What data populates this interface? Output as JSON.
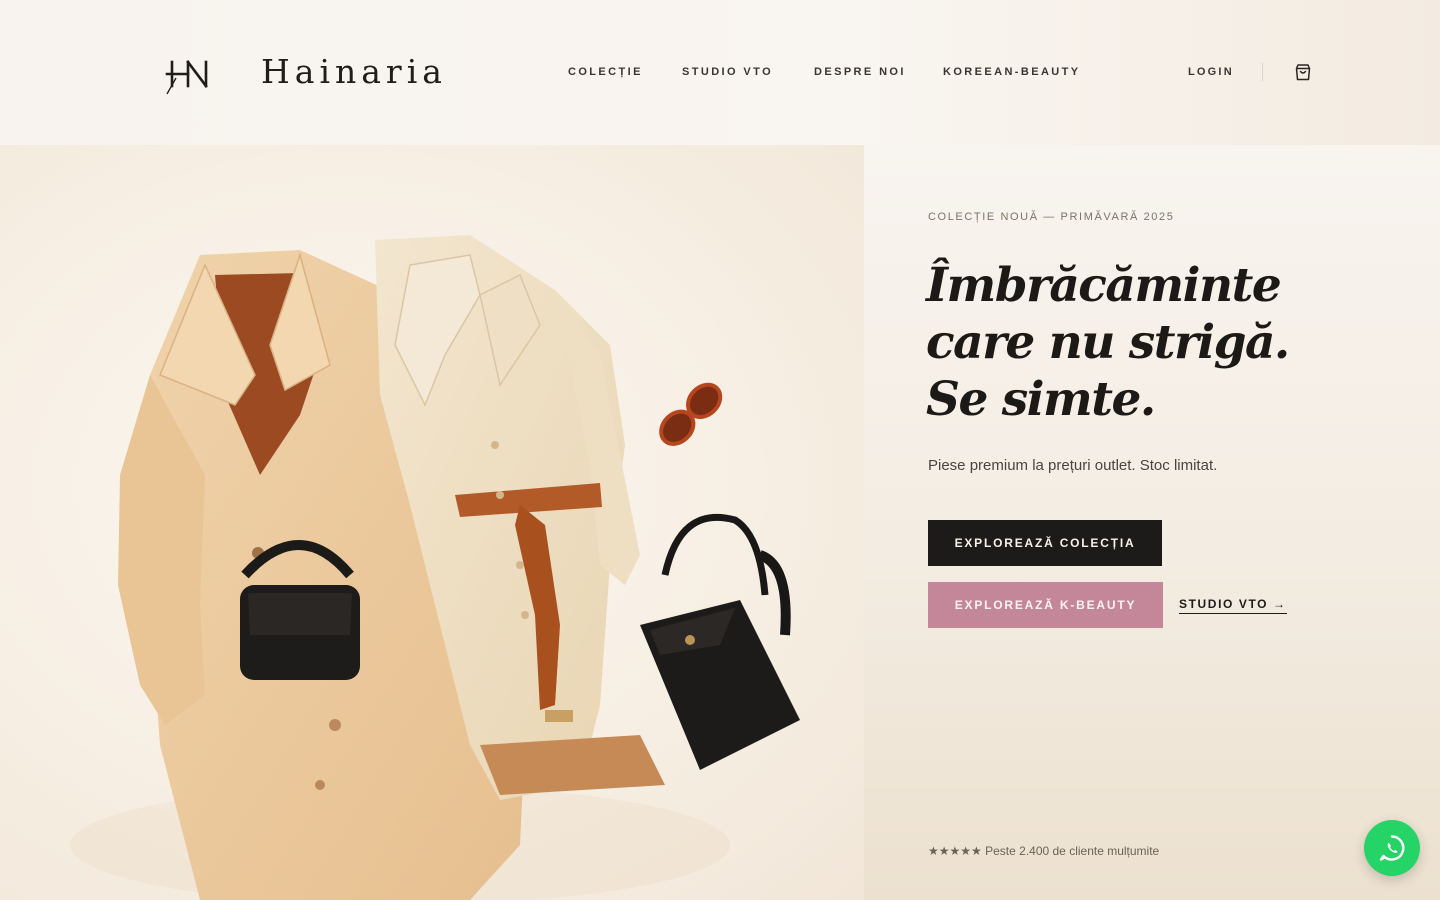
{
  "brand": {
    "name": "Hainaria",
    "logo_icon": "hn-monogram-icon"
  },
  "nav": {
    "items": [
      {
        "label": "COLECȚIE"
      },
      {
        "label": "STUDIO VTO"
      },
      {
        "label": "DESPRE NOI"
      },
      {
        "label": "KOREEAN-BEAUTY"
      }
    ],
    "login_label": "LOGIN",
    "cart_icon": "shopping-bag-icon"
  },
  "hero": {
    "image_icon": "fashion-flatlay-image",
    "eyebrow": "COLECȚIE NOUĂ — PRIMĂVARĂ 2025",
    "headline_lines": [
      "Îmbrăcăminte",
      "care nu strigă.",
      "Se simte."
    ],
    "subtitle": "Piese premium la prețuri outlet. Stoc limitat.",
    "primary_button": "EXPLOREAZĂ COLECȚIA",
    "secondary_button": "EXPLOREAZĂ K-BEAUTY",
    "vto_link": "STUDIO VTO →",
    "rating": "★★★★★ Peste 2.400 de cliente mulțumite"
  },
  "colors": {
    "primary_button_bg": "#1d1b19",
    "secondary_button_bg": "#c4879a",
    "whatsapp_green": "#25d366"
  },
  "whatsapp": {
    "icon": "whatsapp-icon"
  }
}
